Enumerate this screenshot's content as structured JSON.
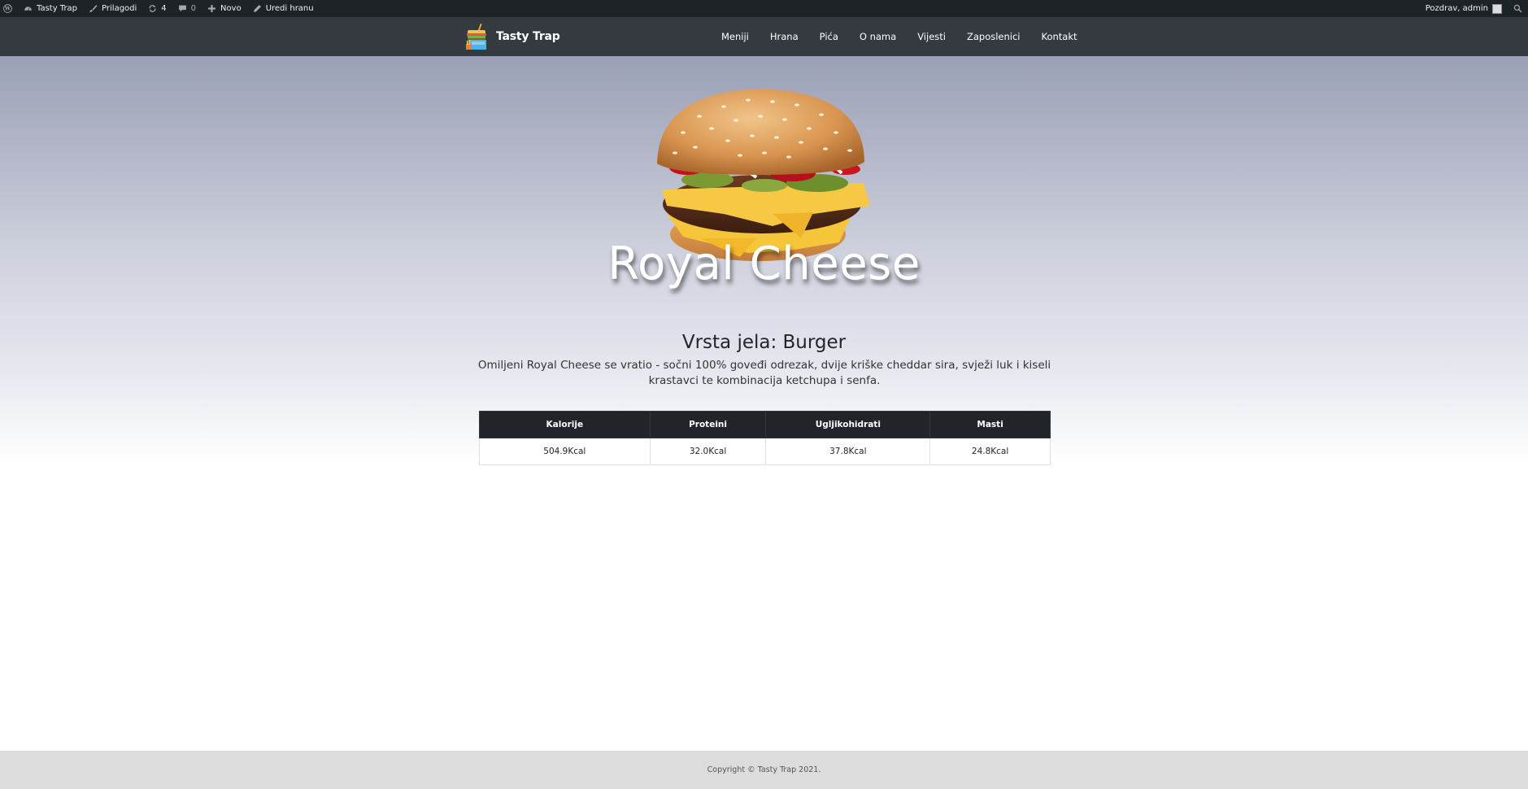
{
  "admin_bar": {
    "site_name": "Tasty Trap",
    "customize": "Prilagodi",
    "updates_count": "4",
    "comments_count": "0",
    "new": "Novo",
    "edit": "Uredi hranu",
    "greeting": "Pozdrav, admin"
  },
  "header": {
    "brand": "Tasty Trap",
    "nav": [
      "Meniji",
      "Hrana",
      "Pića",
      "O nama",
      "Vijesti",
      "Zaposlenici",
      "Kontakt"
    ]
  },
  "dish": {
    "title": "Royal Cheese",
    "type": "Vrsta jela: Burger",
    "description": "Omiljeni Royal Cheese se vratio - sočni 100% goveđi odrezak, dvije kriške cheddar sira, svježi luk i kiseli krastavci te kombinacija ketchupa i senfa."
  },
  "nutrition": {
    "headers": [
      "Kalorije",
      "Proteini",
      "Ugljikohidrati",
      "Masti"
    ],
    "values": [
      "504.9Kcal",
      "32.0Kcal",
      "37.8Kcal",
      "24.8Kcal"
    ]
  },
  "footer": {
    "copyright": "Copyright © Tasty Trap 2021."
  },
  "colors": {
    "admin_bar_bg": "#1d2327",
    "header_bg": "#343a40",
    "table_head_bg": "#212529",
    "footer_bg": "#dcdcdc"
  }
}
